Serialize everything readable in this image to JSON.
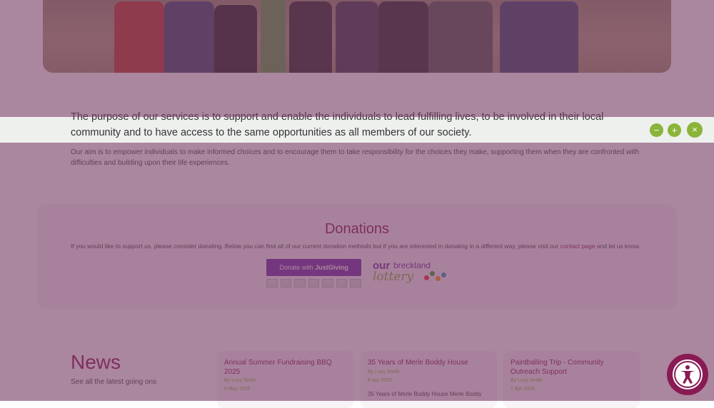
{
  "lead": {
    "primary": "The purpose of our services is to support and enable the individuals to lead fulfilling lives, to be involved in their local community and to have access to the same opportunities as all members of our society.",
    "secondary": "Our aim is to empower individuals to make informed choices and to encourage them to take responsibility for the choices they make, supporting them when they are confronted with difficulties and building upon their life experiences."
  },
  "donations": {
    "title": "Donations",
    "text_before": "If you would like to support us, please consider donating. Below you can find all of our current donation methods but if you are interested in donating in a different way, please visit our ",
    "link": "contact page",
    "text_after": " and let us know.",
    "justgiving_prefix": "Donate with ",
    "justgiving_brand": "JustGiving",
    "lottery_our": "our",
    "lottery_breckland": "breckland",
    "lottery_word": "lottery"
  },
  "news": {
    "title": "News",
    "subtitle": "See all the latest going ons",
    "cards": [
      {
        "title": "Annual Summer Fundraising BBQ 2025",
        "author": "By Lucy Smith",
        "date": "5 May 2025",
        "excerpt": ""
      },
      {
        "title": "35 Years of Merle Boddy House",
        "author": "By Lucy Smith",
        "date": "9 Apr 2025",
        "excerpt": "35 Years of Merle Boddy House Merle Boddy"
      },
      {
        "title": "Paintballing Trip - Community Outreach Support",
        "author": "By Lucy Smith",
        "date": "7 Apr 2025",
        "excerpt": ""
      }
    ]
  },
  "reading_bar": {
    "minus_label": "−",
    "plus_label": "+",
    "close_label": "×"
  },
  "colors": {
    "brand": "#8a1a54",
    "accent": "#8bb43a",
    "overlay": "#783c64"
  }
}
